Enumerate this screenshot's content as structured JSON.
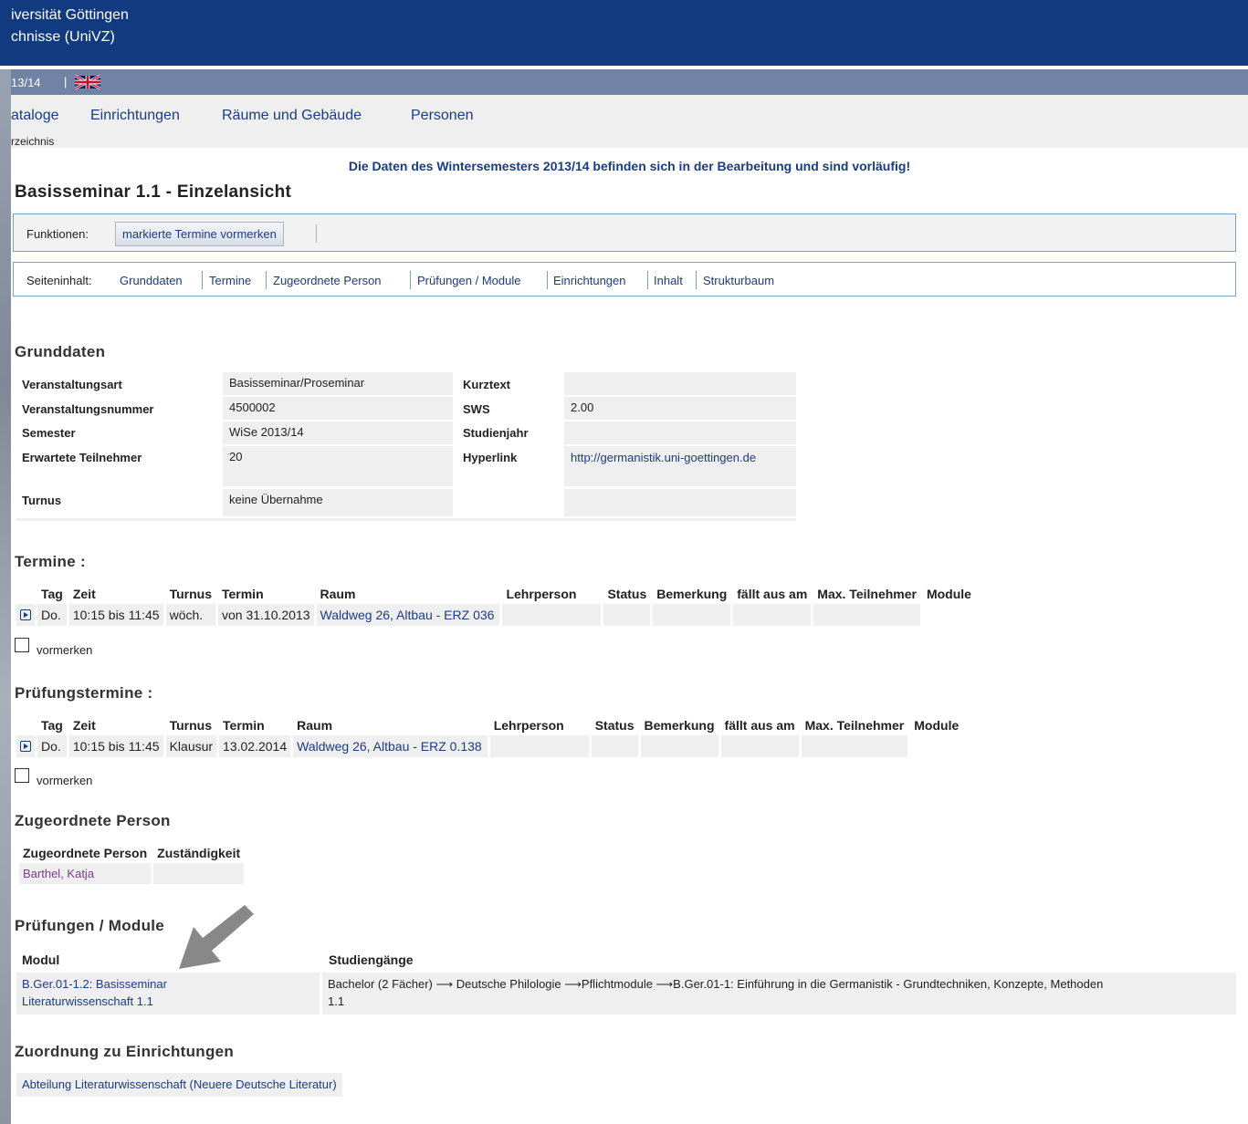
{
  "header": {
    "line1": "iversität Göttingen",
    "line2": "chnisse (UniVZ)"
  },
  "semester_bar": {
    "semester": "13/14",
    "separator": "|",
    "flag_icon": "uk-flag-icon"
  },
  "nav": {
    "items": [
      "ataloge",
      "Einrichtungen",
      "Räume und Gebäude",
      "Personen"
    ],
    "breadcrumb": "rzeichnis"
  },
  "notice": "Die Daten des Wintersemesters 2013/14 befinden sich in der Bearbeitung und sind vorläufig!",
  "page_title": "Basisseminar 1.1 - Einzelansicht",
  "functions": {
    "label": "Funktionen:",
    "button": "markierte Termine vormerken"
  },
  "page_content": {
    "label": "Seiteninhalt:",
    "links": [
      "Grunddaten",
      "Termine",
      "Zugeordnete Person",
      "Prüfungen / Module",
      "Einrichtungen",
      "Inhalt",
      "Strukturbaum"
    ]
  },
  "grunddaten": {
    "title": "Grunddaten",
    "left_labels": [
      "Veranstaltungsart",
      "Veranstaltungsnummer",
      "Semester",
      "Erwartete Teilnehmer",
      "Turnus"
    ],
    "left_values": [
      "Basisseminar/Proseminar",
      "4500002",
      "WiSe 2013/14",
      "20",
      "keine Übernahme"
    ],
    "right_labels": [
      "Kurztext",
      "SWS",
      "Studienjahr",
      "Hyperlink"
    ],
    "right_values": [
      "",
      "2.00",
      "",
      "http://germanistik.uni-goettingen.de"
    ]
  },
  "termine": {
    "title": "Termine :",
    "headers": [
      "Tag",
      "Zeit",
      "Turnus",
      "Termin",
      "Raum",
      "Lehrperson",
      "Status",
      "Bemerkung",
      "fällt aus am",
      "Max. Teilnehmer",
      "Module"
    ],
    "row": {
      "tag": "Do.",
      "zeit": "10:15 bis 11:45",
      "turnus": "wöch.",
      "termin": "von 31.10.2013",
      "raum": "Waldweg 26, Altbau - ERZ 036"
    },
    "checkbox_label": "vormerken"
  },
  "pruefungstermine": {
    "title": "Prüfungstermine :",
    "headers": [
      "Tag",
      "Zeit",
      "Turnus",
      "Termin",
      "Raum",
      "Lehrperson",
      "Status",
      "Bemerkung",
      "fällt aus am",
      "Max. Teilnehmer",
      "Module"
    ],
    "row": {
      "tag": "Do.",
      "zeit": "10:15 bis 11:45",
      "turnus": "Klausur",
      "termin": "13.02.2014",
      "raum": "Waldweg 26, Altbau - ERZ 0.138"
    },
    "checkbox_label": "vormerken"
  },
  "zugeordnete_person": {
    "title": "Zugeordnete Person",
    "headers": [
      "Zugeordnete Person",
      "Zuständigkeit"
    ],
    "person": "Barthel, Katja",
    "zustaendigkeit": ""
  },
  "pruefungen_module": {
    "title": "Prüfungen / Module",
    "headers": [
      "Modul",
      "Studiengänge"
    ],
    "modul_line1": "B.Ger.01-1.2: Basisseminar",
    "modul_line2": "Literaturwissenschaft 1.1",
    "studiengaenge_line1": "Bachelor (2 Fächer) ⟶ Deutsche Philologie ⟶Pflichtmodule ⟶B.Ger.01-1: Einführung in die Germanistik - Grundtechniken, Konzepte, Methoden",
    "studiengaenge_line2": "1.1"
  },
  "einrichtungen": {
    "title": "Zuordnung zu Einrichtungen",
    "item": "Abteilung Literaturwissenschaft (Neuere Deutsche Literatur)"
  },
  "colors": {
    "header_bg": "#123a80",
    "semester_bar_bg": "#7083a5",
    "link": "#1a3c82",
    "person_link": "#7a3d8a",
    "cell_bg": "#efefef",
    "arrow": "#888888"
  }
}
